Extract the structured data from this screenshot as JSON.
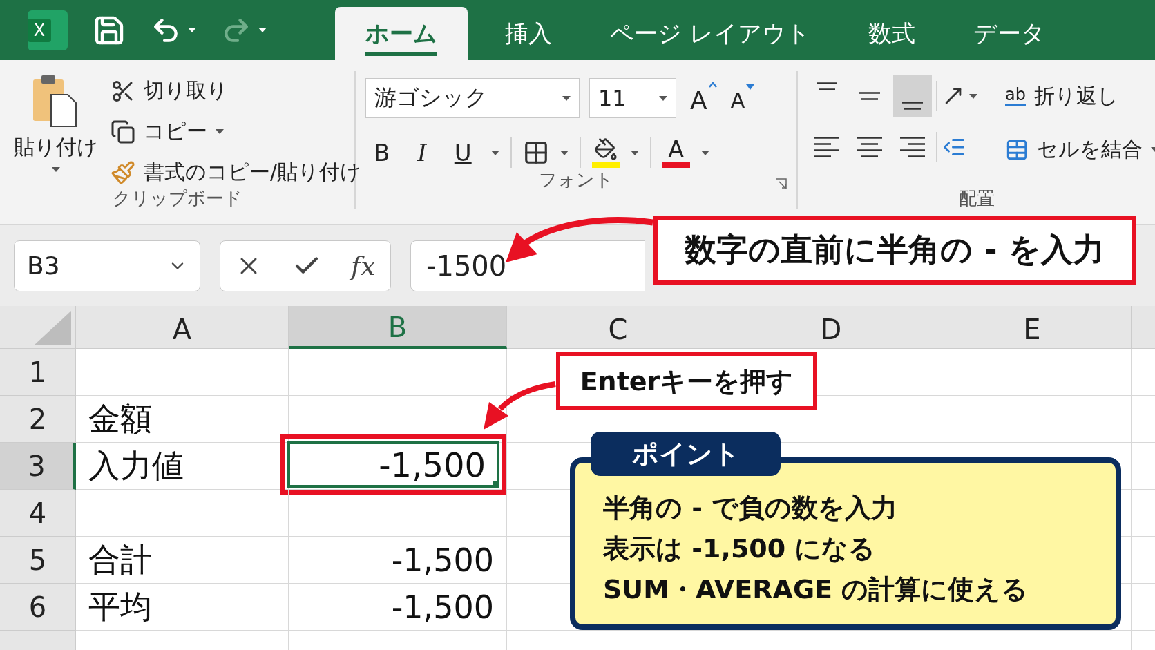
{
  "app_logo": {
    "letter": "X"
  },
  "tabs": [
    {
      "label": "ホーム",
      "selected": true
    },
    {
      "label": "挿入",
      "selected": false
    },
    {
      "label": "ページ レイアウト",
      "selected": false
    },
    {
      "label": "数式",
      "selected": false
    },
    {
      "label": "データ",
      "selected": false
    }
  ],
  "clipboard": {
    "label": "クリップボード",
    "paste": "貼り付け",
    "commands": [
      {
        "kind": "cut",
        "label": "切り取り",
        "dropdown": false
      },
      {
        "kind": "copy",
        "label": "コピー",
        "dropdown": true
      },
      {
        "kind": "format",
        "label": "書式のコピー/貼り付け",
        "dropdown": false
      }
    ]
  },
  "font": {
    "label": "フォント",
    "font_name": "游ゴシック",
    "font_size": "11",
    "size_buttons": [
      {
        "kind": "grow",
        "letter": "A"
      },
      {
        "kind": "shrink",
        "letter": "A"
      }
    ],
    "style_buttons": [
      {
        "kind": "bold",
        "letter": "B"
      },
      {
        "kind": "italic",
        "letter": "I"
      },
      {
        "kind": "underline",
        "letter": "U"
      }
    ],
    "font_color_letter": "A"
  },
  "alignment": {
    "label": "配置",
    "vertical": [
      {
        "kind": "top",
        "selected": false
      },
      {
        "kind": "middle",
        "selected": false
      },
      {
        "kind": "bottom",
        "selected": true
      }
    ],
    "horizontal": [
      {
        "kind": "left",
        "selected": false
      },
      {
        "kind": "center",
        "selected": false
      },
      {
        "kind": "right",
        "selected": false
      }
    ],
    "wrap_icon_text": "ab",
    "wrap": "折り返し",
    "merge": "セルを結合"
  },
  "formula_bar": {
    "name_box": "B3",
    "fx": "fx",
    "value": "-1500"
  },
  "sheet": {
    "columns": [
      {
        "label": "A",
        "selected": false
      },
      {
        "label": "B",
        "selected": true
      },
      {
        "label": "C",
        "selected": false
      },
      {
        "label": "D",
        "selected": false
      },
      {
        "label": "E",
        "selected": false
      }
    ],
    "rows": [
      {
        "number": "1",
        "selected": false
      },
      {
        "number": "2",
        "selected": false,
        "a": "金額"
      },
      {
        "number": "3",
        "selected": true,
        "a": "入力値",
        "b": "-1,500"
      },
      {
        "number": "4",
        "selected": false
      },
      {
        "number": "5",
        "selected": false,
        "a": "合計",
        "b": "-1,500"
      },
      {
        "number": "6",
        "selected": false,
        "a": "平均",
        "b": "-1,500"
      }
    ]
  },
  "annotations": {
    "formula_callout": "数字の直前に半角の - を入力",
    "enter_callout": "Enterキーを押す",
    "point": {
      "title": "ポイント",
      "lines": [
        "半角の - で負の数を入力",
        "表示は -1,500 になる",
        "SUM・AVERAGE の計算に使える"
      ]
    }
  }
}
